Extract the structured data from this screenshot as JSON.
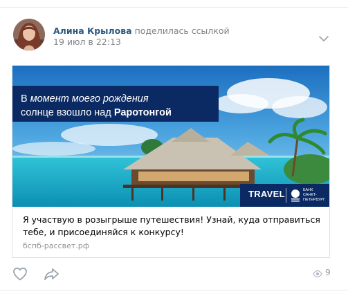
{
  "post": {
    "author_name": "Алина Крылова",
    "action": "поделилась ссылкой",
    "date": "19 июл в 22:13"
  },
  "link": {
    "banner": {
      "headline_line1_prefix": "В ",
      "headline_line1_emph": "момент моего рождения",
      "headline_line2_prefix": "солнце взошло над ",
      "headline_line2_bold": "Раротонгой",
      "brand_label": "TRAVEL",
      "bank_name": "БАНК\nСАНКТ-\nПЕТЕРБУРГ"
    },
    "text": "Я участвую в розыгрыше путешествия! Узнай, куда отправиться тебе, и присоединяйся к конкурсу!",
    "domain": "бспб-рассвет.рф"
  },
  "footer": {
    "views": "9"
  },
  "colors": {
    "link_blue": "#2a5885",
    "muted": "#828282",
    "banner_navy": "#0b2a63",
    "icon_gray": "#99a2ad"
  },
  "icons": [
    "chevron-down-icon",
    "heart-icon",
    "share-arrow-icon",
    "eye-icon",
    "bank-logo-icon"
  ]
}
